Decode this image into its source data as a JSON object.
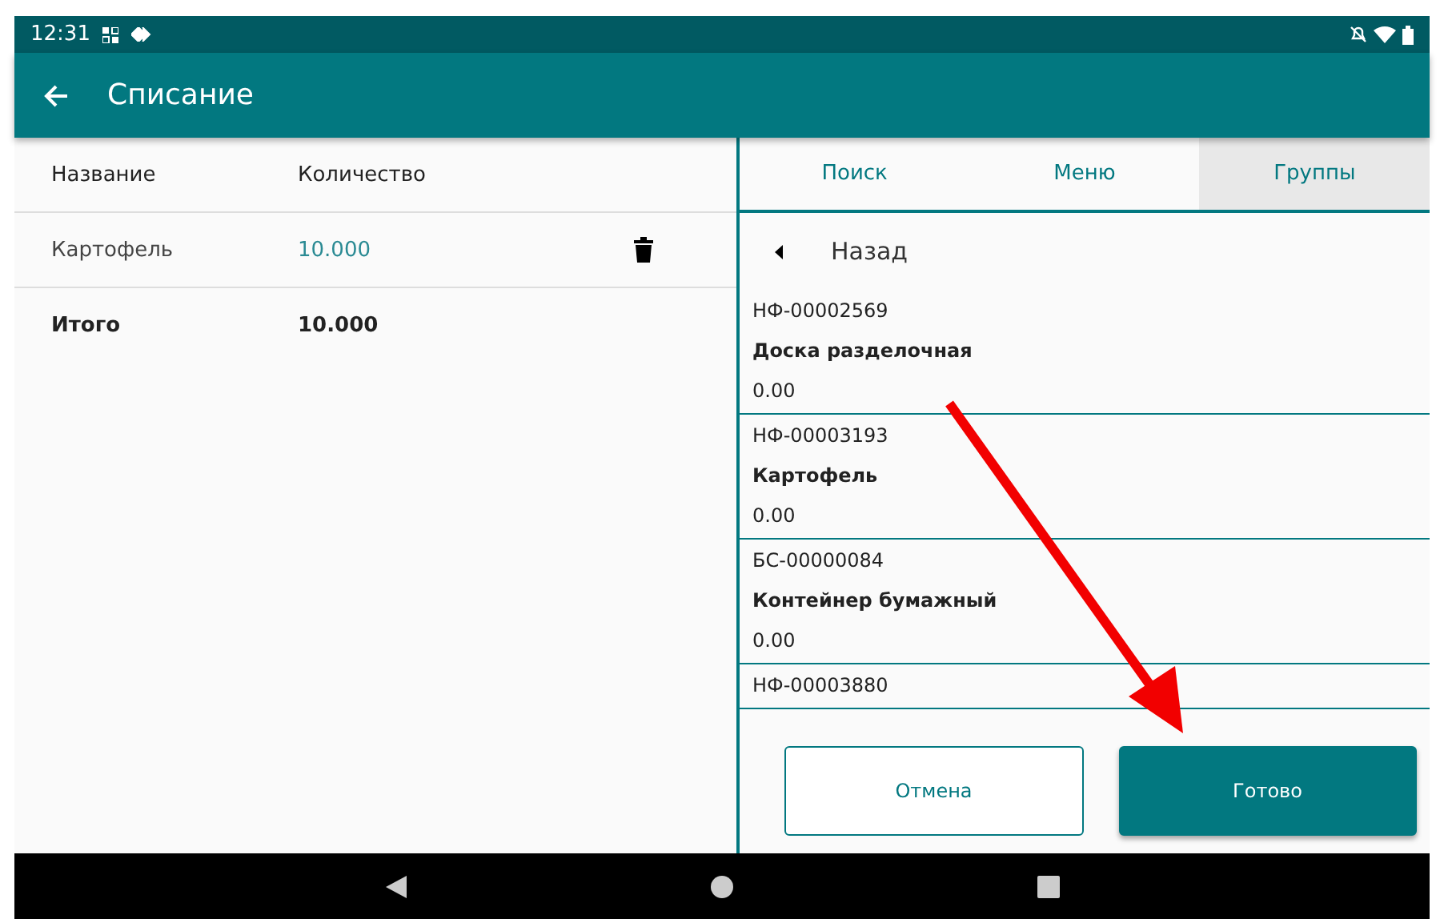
{
  "status_bar": {
    "time": "12:31"
  },
  "app_bar": {
    "title": "Списание"
  },
  "table": {
    "columns": [
      "Название",
      "Количество"
    ],
    "rows": [
      {
        "name": "Картофель",
        "quantity": "10.000"
      }
    ],
    "total": {
      "label": "Итого",
      "quantity": "10.000"
    }
  },
  "tabs": [
    {
      "label": "Поиск",
      "selected": false
    },
    {
      "label": "Меню",
      "selected": false
    },
    {
      "label": "Группы",
      "selected": true
    }
  ],
  "back": {
    "label": "Назад"
  },
  "products": [
    {
      "code": "НФ-00002569",
      "name": "Доска разделочная",
      "quantity": "0.00"
    },
    {
      "code": "НФ-00003193",
      "name": "Картофель",
      "quantity": "0.00"
    },
    {
      "code": "БС-00000084",
      "name": "Контейнер бумажный",
      "quantity": "0.00"
    },
    {
      "code": "НФ-00003880"
    }
  ],
  "buttons": [
    {
      "label": "Отмена",
      "kind": "outline"
    },
    {
      "label": "Готово",
      "kind": "filled"
    }
  ]
}
